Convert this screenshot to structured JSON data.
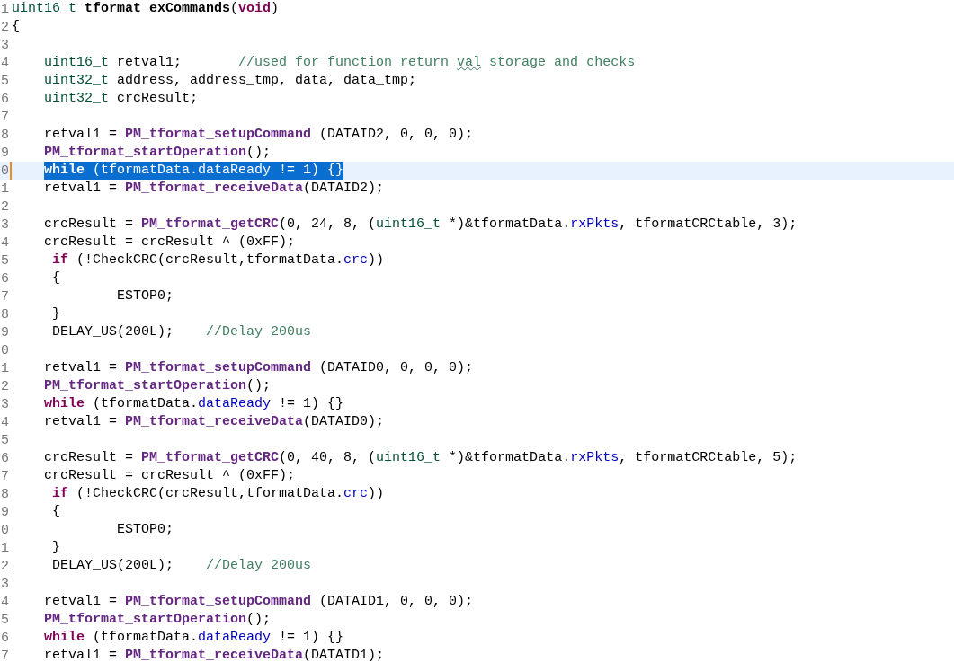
{
  "editor": {
    "lines": [
      {
        "number": "1",
        "current": false,
        "tokens": [
          {
            "kind": "type",
            "text": "uint16_t"
          },
          {
            "kind": "declaration",
            "text": " tformat_exCommands"
          },
          {
            "kind": "plain",
            "text": "("
          },
          {
            "kind": "keyword",
            "text": "void"
          },
          {
            "kind": "plain",
            "text": ")"
          }
        ]
      },
      {
        "number": "2",
        "current": false,
        "tokens": [
          {
            "kind": "plain",
            "text": "{"
          }
        ]
      },
      {
        "number": "3",
        "current": false
      },
      {
        "number": "4",
        "current": false,
        "tokens": [
          {
            "kind": "type",
            "text": "    uint16_t"
          },
          {
            "kind": "plain",
            "text": " retval1;       "
          },
          {
            "kind": "comment",
            "text": "//used for function return "
          },
          {
            "kind": "misspelled",
            "text": "val"
          },
          {
            "kind": "comment",
            "text": " storage and checks"
          }
        ]
      },
      {
        "number": "5",
        "current": false,
        "tokens": [
          {
            "kind": "type",
            "text": "    uint32_t"
          },
          {
            "kind": "plain",
            "text": " address, address_tmp, data, data_tmp;"
          }
        ]
      },
      {
        "number": "6",
        "current": false,
        "tokens": [
          {
            "kind": "type",
            "text": "    uint32_t"
          },
          {
            "kind": "plain",
            "text": " crcResult;"
          }
        ]
      },
      {
        "number": "7",
        "current": false
      },
      {
        "number": "8",
        "current": false,
        "tokens": [
          {
            "kind": "plain",
            "text": "    retval1 = "
          },
          {
            "kind": "function",
            "text": "PM_tformat_setupCommand"
          },
          {
            "kind": "plain",
            "text": " (DATAID2, 0, 0, 0);"
          }
        ]
      },
      {
        "number": "9",
        "current": false,
        "tokens": [
          {
            "kind": "function",
            "text": "    PM_tformat_startOperation"
          },
          {
            "kind": "plain",
            "text": "();"
          }
        ]
      },
      {
        "number": "0",
        "current": true,
        "tokens": [
          {
            "kind": "keyword",
            "text": "    while",
            "selected": true
          },
          {
            "kind": "plain",
            "text": " (tformatData.",
            "selected": true
          },
          {
            "kind": "field",
            "text": "dataReady",
            "selected": true
          },
          {
            "kind": "plain",
            "text": " != 1) {}",
            "selected": true
          }
        ]
      },
      {
        "number": "1",
        "current": false,
        "tokens": [
          {
            "kind": "plain",
            "text": "    retval1 = "
          },
          {
            "kind": "function",
            "text": "PM_tformat_receiveData"
          },
          {
            "kind": "plain",
            "text": "(DATAID2);"
          }
        ]
      },
      {
        "number": "2",
        "current": false
      },
      {
        "number": "3",
        "current": false,
        "tokens": [
          {
            "kind": "plain",
            "text": "    crcResult = "
          },
          {
            "kind": "function",
            "text": "PM_tformat_getCRC"
          },
          {
            "kind": "plain",
            "text": "(0, 24, 8, ("
          },
          {
            "kind": "type",
            "text": "uint16_t"
          },
          {
            "kind": "plain",
            "text": " *)&tformatData."
          },
          {
            "kind": "field",
            "text": "rxPkts"
          },
          {
            "kind": "plain",
            "text": ", tformatCRCtable, 3);"
          }
        ]
      },
      {
        "number": "4",
        "current": false,
        "tokens": [
          {
            "kind": "plain",
            "text": "    crcResult = crcResult ^ (0xFF);"
          }
        ]
      },
      {
        "number": "5",
        "current": false,
        "tokens": [
          {
            "kind": "keyword",
            "text": "     if"
          },
          {
            "kind": "plain",
            "text": " (!CheckCRC(crcResult,tformatData."
          },
          {
            "kind": "field",
            "text": "crc"
          },
          {
            "kind": "plain",
            "text": "))"
          }
        ]
      },
      {
        "number": "6",
        "current": false,
        "tokens": [
          {
            "kind": "plain",
            "text": "     {"
          }
        ]
      },
      {
        "number": "7",
        "current": false,
        "tokens": [
          {
            "kind": "plain",
            "text": "             ESTOP0;"
          }
        ]
      },
      {
        "number": "8",
        "current": false,
        "tokens": [
          {
            "kind": "plain",
            "text": "     }"
          }
        ]
      },
      {
        "number": "9",
        "current": false,
        "tokens": [
          {
            "kind": "plain",
            "text": "     DELAY_US(200L);    "
          },
          {
            "kind": "comment",
            "text": "//Delay 200us"
          }
        ]
      },
      {
        "number": "0",
        "current": false
      },
      {
        "number": "1",
        "current": false,
        "tokens": [
          {
            "kind": "plain",
            "text": "    retval1 = "
          },
          {
            "kind": "function",
            "text": "PM_tformat_setupCommand"
          },
          {
            "kind": "plain",
            "text": " (DATAID0, 0, 0, 0);"
          }
        ]
      },
      {
        "number": "2",
        "current": false,
        "tokens": [
          {
            "kind": "function",
            "text": "    PM_tformat_startOperation"
          },
          {
            "kind": "plain",
            "text": "();"
          }
        ]
      },
      {
        "number": "3",
        "current": false,
        "tokens": [
          {
            "kind": "keyword",
            "text": "    while"
          },
          {
            "kind": "plain",
            "text": " (tformatData."
          },
          {
            "kind": "field",
            "text": "dataReady"
          },
          {
            "kind": "plain",
            "text": " != 1) {}"
          }
        ]
      },
      {
        "number": "4",
        "current": false,
        "tokens": [
          {
            "kind": "plain",
            "text": "    retval1 = "
          },
          {
            "kind": "function",
            "text": "PM_tformat_receiveData"
          },
          {
            "kind": "plain",
            "text": "(DATAID0);"
          }
        ]
      },
      {
        "number": "5",
        "current": false
      },
      {
        "number": "6",
        "current": false,
        "tokens": [
          {
            "kind": "plain",
            "text": "    crcResult = "
          },
          {
            "kind": "function",
            "text": "PM_tformat_getCRC"
          },
          {
            "kind": "plain",
            "text": "(0, 40, 8, ("
          },
          {
            "kind": "type",
            "text": "uint16_t"
          },
          {
            "kind": "plain",
            "text": " *)&tformatData."
          },
          {
            "kind": "field",
            "text": "rxPkts"
          },
          {
            "kind": "plain",
            "text": ", tformatCRCtable, 5);"
          }
        ]
      },
      {
        "number": "7",
        "current": false,
        "tokens": [
          {
            "kind": "plain",
            "text": "    crcResult = crcResult ^ (0xFF);"
          }
        ]
      },
      {
        "number": "8",
        "current": false,
        "tokens": [
          {
            "kind": "keyword",
            "text": "     if"
          },
          {
            "kind": "plain",
            "text": " (!CheckCRC(crcResult,tformatData."
          },
          {
            "kind": "field",
            "text": "crc"
          },
          {
            "kind": "plain",
            "text": "))"
          }
        ]
      },
      {
        "number": "9",
        "current": false,
        "tokens": [
          {
            "kind": "plain",
            "text": "     {"
          }
        ]
      },
      {
        "number": "0",
        "current": false,
        "tokens": [
          {
            "kind": "plain",
            "text": "             ESTOP0;"
          }
        ]
      },
      {
        "number": "1",
        "current": false,
        "tokens": [
          {
            "kind": "plain",
            "text": "     }"
          }
        ]
      },
      {
        "number": "2",
        "current": false,
        "tokens": [
          {
            "kind": "plain",
            "text": "     DELAY_US(200L);    "
          },
          {
            "kind": "comment",
            "text": "//Delay 200us"
          }
        ]
      },
      {
        "number": "3",
        "current": false
      },
      {
        "number": "4",
        "current": false,
        "tokens": [
          {
            "kind": "plain",
            "text": "    retval1 = "
          },
          {
            "kind": "function",
            "text": "PM_tformat_setupCommand"
          },
          {
            "kind": "plain",
            "text": " (DATAID1, 0, 0, 0);"
          }
        ]
      },
      {
        "number": "5",
        "current": false,
        "tokens": [
          {
            "kind": "function",
            "text": "    PM_tformat_startOperation"
          },
          {
            "kind": "plain",
            "text": "();"
          }
        ]
      },
      {
        "number": "6",
        "current": false,
        "tokens": [
          {
            "kind": "keyword",
            "text": "    while"
          },
          {
            "kind": "plain",
            "text": " (tformatData."
          },
          {
            "kind": "field",
            "text": "dataReady"
          },
          {
            "kind": "plain",
            "text": " != 1) {}"
          }
        ]
      },
      {
        "number": "7",
        "current": false,
        "tokens": [
          {
            "kind": "plain",
            "text": "    retval1 = "
          },
          {
            "kind": "function",
            "text": "PM_tformat_receiveData"
          },
          {
            "kind": "plain",
            "text": "(DATAID1);"
          }
        ]
      }
    ]
  }
}
